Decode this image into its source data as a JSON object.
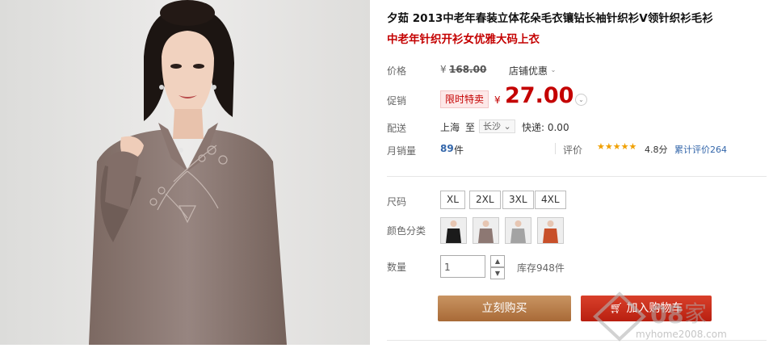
{
  "product": {
    "title": "夕茹 2013中老年春装立体花朵毛衣镶钻长袖针织衫V领针织衫毛衫",
    "subtitle": "中老年针织开衫女优雅大码上衣"
  },
  "price_row": {
    "label": "价格",
    "currency": "¥",
    "original": "168.00",
    "shop_discount": "店铺优惠"
  },
  "promo_row": {
    "label": "促销",
    "tag": "限时特卖",
    "currency": "¥",
    "price": "27.00"
  },
  "shipping": {
    "label": "配送",
    "from": "上海",
    "to_word": "至",
    "destination": "长沙",
    "express": "快递: 0.00"
  },
  "sales": {
    "label": "月销量",
    "count": "89",
    "unit": "件",
    "rating_label": "评价",
    "stars": "★★★★★",
    "score": "4.8分",
    "total_reviews": "累计评价264"
  },
  "sizes": {
    "label": "尺码",
    "options": [
      "XL",
      "2XL",
      "3XL",
      "4XL"
    ]
  },
  "colors": {
    "label": "颜色分类",
    "swatches": [
      {
        "shirt": "#1b1b1b"
      },
      {
        "shirt": "#8d7873"
      },
      {
        "shirt": "#a3a3a3"
      },
      {
        "shirt": "#c8502a"
      }
    ]
  },
  "quantity": {
    "label": "数量",
    "value": "1",
    "stock": "库存948件"
  },
  "actions": {
    "buy_now": "立刻购买",
    "add_to_cart": "加入购物车"
  },
  "watermark": {
    "text": "家",
    "url": "myhome2008.com"
  },
  "colors_theme": {
    "accent": "#c40000",
    "buy": "#b57b48",
    "cart": "#c92e1a",
    "link": "#3366aa"
  }
}
